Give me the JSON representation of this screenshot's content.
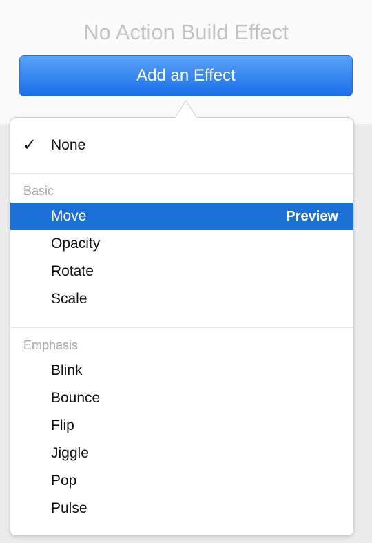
{
  "header": {
    "title": "No Action Build Effect",
    "button_label": "Add an Effect"
  },
  "menu": {
    "none_label": "None",
    "check_glyph": "✓",
    "sections": [
      {
        "label": "Basic",
        "items": [
          "Move",
          "Opacity",
          "Rotate",
          "Scale"
        ]
      },
      {
        "label": "Emphasis",
        "items": [
          "Blink",
          "Bounce",
          "Flip",
          "Jiggle",
          "Pop",
          "Pulse"
        ]
      }
    ],
    "selected_item": "Move",
    "selected_action": "Preview"
  },
  "colors": {
    "accent": "#1b6fd6",
    "button_top": "#5aa2f6",
    "button_bottom": "#1a6fe8",
    "title_gray": "#c4c4c4",
    "section_gray": "#a7a7a7"
  },
  "icons": {
    "checkmark": "check-icon"
  }
}
